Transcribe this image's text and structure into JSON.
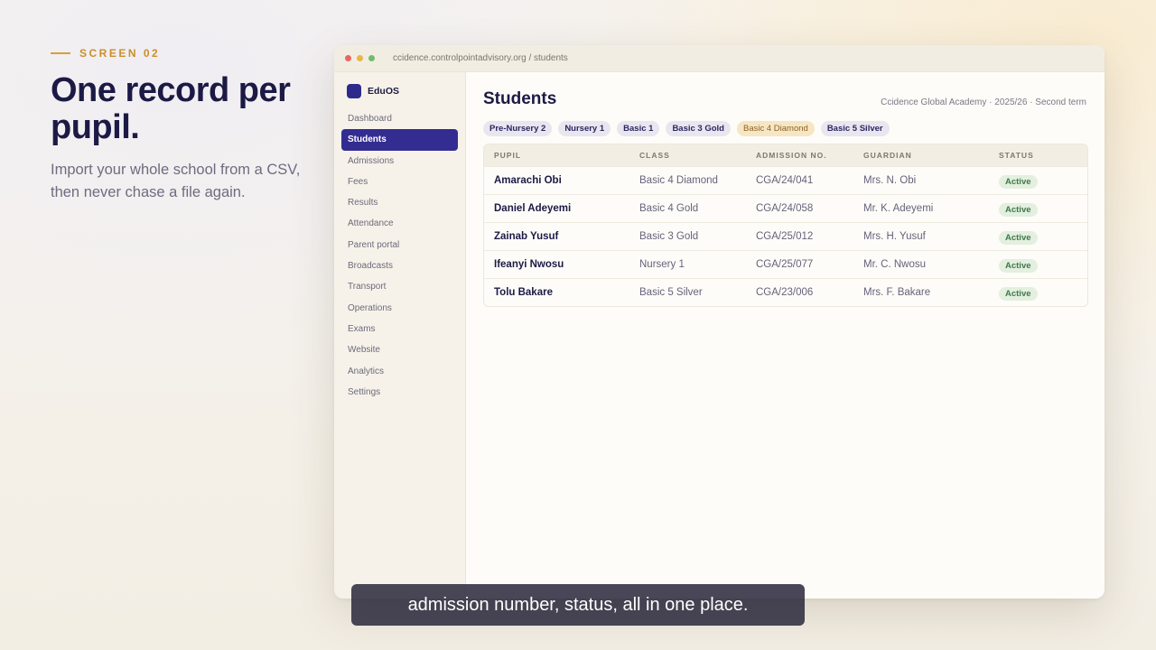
{
  "hero": {
    "eyebrow": "SCREEN 02",
    "title": "One record per pupil.",
    "subtitle": "Import your whole school from a CSV, then never chase a file again."
  },
  "browser": {
    "url": "ccidence.controlpointadvisory.org / students",
    "dot_colors": [
      "#e7685c",
      "#e8b64a",
      "#6cbf6a"
    ]
  },
  "sidebar": {
    "brand": "EduOS",
    "items": [
      {
        "label": "Dashboard"
      },
      {
        "label": "Students",
        "active": true
      },
      {
        "label": "Admissions"
      },
      {
        "label": "Fees"
      },
      {
        "label": "Results"
      },
      {
        "label": "Attendance"
      },
      {
        "label": "Parent portal"
      },
      {
        "label": "Broadcasts"
      },
      {
        "label": "Transport"
      },
      {
        "label": "Operations"
      },
      {
        "label": "Exams"
      },
      {
        "label": "Website"
      },
      {
        "label": "Analytics"
      },
      {
        "label": "Settings"
      }
    ]
  },
  "main": {
    "title": "Students",
    "context": "Ccidence Global Academy · 2025/26 · Second term",
    "filters": [
      {
        "label": "Pre-Nursery 2"
      },
      {
        "label": "Nursery 1"
      },
      {
        "label": "Basic 1"
      },
      {
        "label": "Basic 3 Gold"
      },
      {
        "label": "Basic 4 Diamond",
        "active": true
      },
      {
        "label": "Basic 5 Silver"
      }
    ],
    "table": {
      "headers": [
        "PUPIL",
        "CLASS",
        "ADMISSION NO.",
        "GUARDIAN",
        "STATUS"
      ],
      "rows": [
        {
          "pupil": "Amarachi Obi",
          "class": "Basic 4 Diamond",
          "admission": "CGA/24/041",
          "guardian": "Mrs. N. Obi",
          "status": "Active"
        },
        {
          "pupil": "Daniel Adeyemi",
          "class": "Basic 4 Gold",
          "admission": "CGA/24/058",
          "guardian": "Mr. K. Adeyemi",
          "status": "Active"
        },
        {
          "pupil": "Zainab Yusuf",
          "class": "Basic 3 Gold",
          "admission": "CGA/25/012",
          "guardian": "Mrs. H. Yusuf",
          "status": "Active"
        },
        {
          "pupil": "Ifeanyi Nwosu",
          "class": "Nursery 1",
          "admission": "CGA/25/077",
          "guardian": "Mr. C. Nwosu",
          "status": "Active"
        },
        {
          "pupil": "Tolu Bakare",
          "class": "Basic 5 Silver",
          "admission": "CGA/23/006",
          "guardian": "Mrs. F. Bakare",
          "status": "Active"
        }
      ]
    }
  },
  "caption": "admission number, status, all in one place."
}
